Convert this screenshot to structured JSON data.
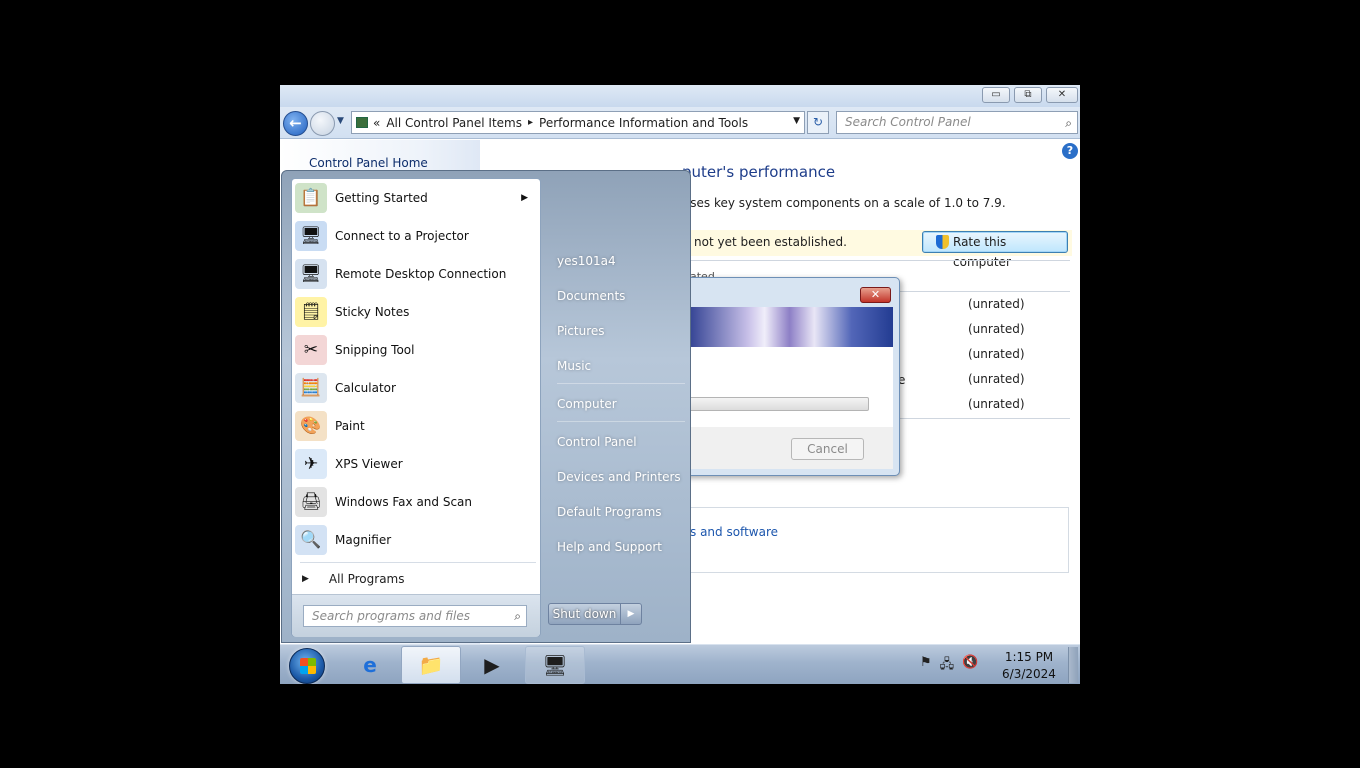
{
  "window": {
    "buttons": {
      "minimize": "▭",
      "maximize": "⧉",
      "close": "✕"
    },
    "address": {
      "overflow": "«",
      "crumb1": "All Control Panel Items",
      "crumb2": "Performance Information and Tools",
      "separator": "▸"
    },
    "search_placeholder": "Search Control Panel"
  },
  "left_pane": {
    "home_link": "Control Panel Home"
  },
  "content": {
    "heading": "Rate and improve your computer's performance",
    "heading_visible": "puter's performance",
    "description_visible": "sses key system components on a scale of 1.0 to 7.9.",
    "notice_visible": "not yet been established.",
    "rate_button": "Rate this computer",
    "faint_text": "ated",
    "scores": [
      "(unrated)",
      "(unrated)",
      "(unrated)",
      "(unrated)",
      "(unrated)"
    ],
    "side_letter": "e",
    "tips_link_visible": "s and software"
  },
  "dialog": {
    "close": "✕",
    "cancel_label": "Cancel",
    "progress_fraction": 0.0
  },
  "start_menu": {
    "programs": [
      {
        "label": "Getting Started",
        "icon": "getting-started-icon",
        "glyph": "📋",
        "has_submenu": true
      },
      {
        "label": "Connect to a Projector",
        "icon": "projector-icon",
        "glyph": "🖥",
        "has_submenu": false
      },
      {
        "label": "Remote Desktop Connection",
        "icon": "remote-desktop-icon",
        "glyph": "🖥",
        "has_submenu": false
      },
      {
        "label": "Sticky Notes",
        "icon": "sticky-notes-icon",
        "glyph": "🗒",
        "has_submenu": false
      },
      {
        "label": "Snipping Tool",
        "icon": "snipping-tool-icon",
        "glyph": "✂",
        "has_submenu": false
      },
      {
        "label": "Calculator",
        "icon": "calculator-icon",
        "glyph": "🧮",
        "has_submenu": false
      },
      {
        "label": "Paint",
        "icon": "paint-icon",
        "glyph": "🎨",
        "has_submenu": false
      },
      {
        "label": "XPS Viewer",
        "icon": "xps-viewer-icon",
        "glyph": "✈",
        "has_submenu": false
      },
      {
        "label": "Windows Fax and Scan",
        "icon": "fax-scan-icon",
        "glyph": "🖨",
        "has_submenu": false
      },
      {
        "label": "Magnifier",
        "icon": "magnifier-icon",
        "glyph": "🔍",
        "has_submenu": false
      }
    ],
    "all_programs": "All Programs",
    "search_placeholder": "Search programs and files",
    "right_items": [
      "yes101a4",
      "Documents",
      "Pictures",
      "Music",
      "Computer",
      "Control Panel",
      "Devices and Printers",
      "Default Programs",
      "Help and Support"
    ],
    "shutdown_label": "Shut down"
  },
  "taskbar": {
    "clock_time": "1:15 PM",
    "clock_date": "6/3/2024"
  }
}
